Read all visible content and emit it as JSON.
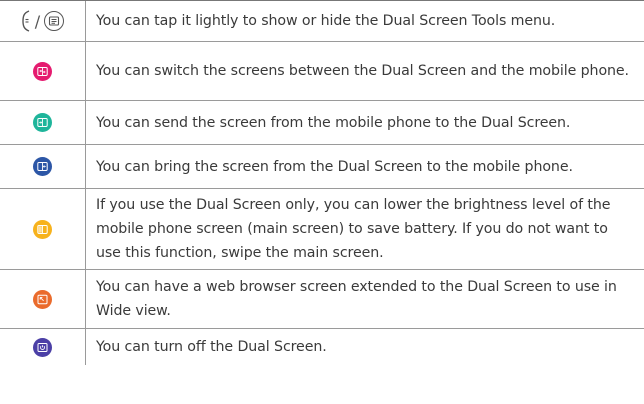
{
  "rows": [
    {
      "icon": "dual-screen-tools-toggle-icons",
      "text": "You can tap it lightly to show or hide the Dual Screen Tools menu."
    },
    {
      "icon": "swap-screens-icon",
      "color": "#e51b6f",
      "text": "You can switch the screens between the Dual Screen and the mobile phone."
    },
    {
      "icon": "send-to-dual-screen-icon",
      "color": "#1fb59b",
      "text": "You can send the screen from the mobile phone to the Dual Screen."
    },
    {
      "icon": "bring-to-phone-icon",
      "color": "#2c56a6",
      "text": "You can bring the screen from the Dual Screen to the mobile phone."
    },
    {
      "icon": "main-screen-off-icon",
      "color": "#f7b21c",
      "text": "If you use the Dual Screen only, you can lower the brightness level of the mobile phone screen (main screen) to save battery. If you do not want to use this function, swipe the main screen."
    },
    {
      "icon": "wide-view-icon",
      "color": "#ea6b2c",
      "text": "You can have a web browser screen extended to the Dual Screen to use in Wide view."
    },
    {
      "icon": "dual-screen-off-icon",
      "color": "#4b3fa6",
      "text": "You can turn off the Dual Screen."
    }
  ],
  "first_row_separator": "/"
}
